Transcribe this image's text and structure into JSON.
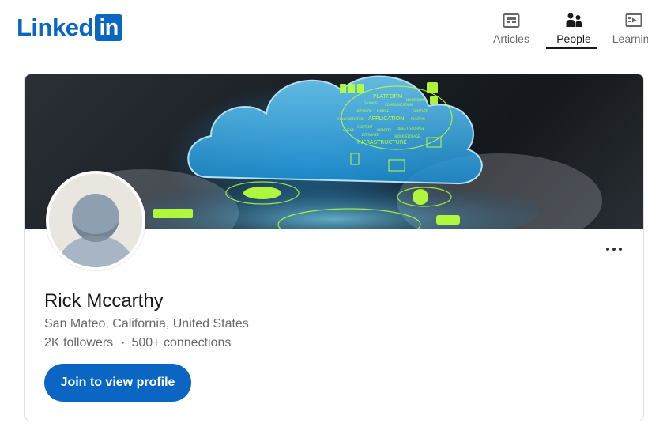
{
  "brand": {
    "logo_word": "Linked",
    "logo_box": "in",
    "color": "#0a66c2"
  },
  "nav": {
    "items": [
      {
        "label": "Articles",
        "icon": "articles-icon",
        "active": false
      },
      {
        "label": "People",
        "icon": "people-icon",
        "active": true
      },
      {
        "label": "Learning",
        "icon": "learning-icon",
        "active": false
      }
    ]
  },
  "profile": {
    "name": "Rick Mccarthy",
    "location": "San Mateo, California, United States",
    "followers": "2K followers",
    "separator": "·",
    "connections": "500+ connections",
    "cta_label": "Join to view profile",
    "cta_color": "#0a66c2",
    "more_icon": "more-horizontal-icon"
  },
  "banner": {
    "words": [
      "PLATFORM",
      "APPLICATION",
      "INFRASTRUCTURE",
      "FINANCE",
      "COMMUNICATION",
      "NETWORK",
      "MOBILE",
      "MONITORING",
      "COLLABORATION",
      "RUNTIME",
      "CONTENT",
      "IDENTITY",
      "OBJECT STORAGE",
      "QUEUE",
      "DATABASE",
      "COMPUTE",
      "BLOCK STORAGE"
    ],
    "accent": "#b6ff3a"
  }
}
